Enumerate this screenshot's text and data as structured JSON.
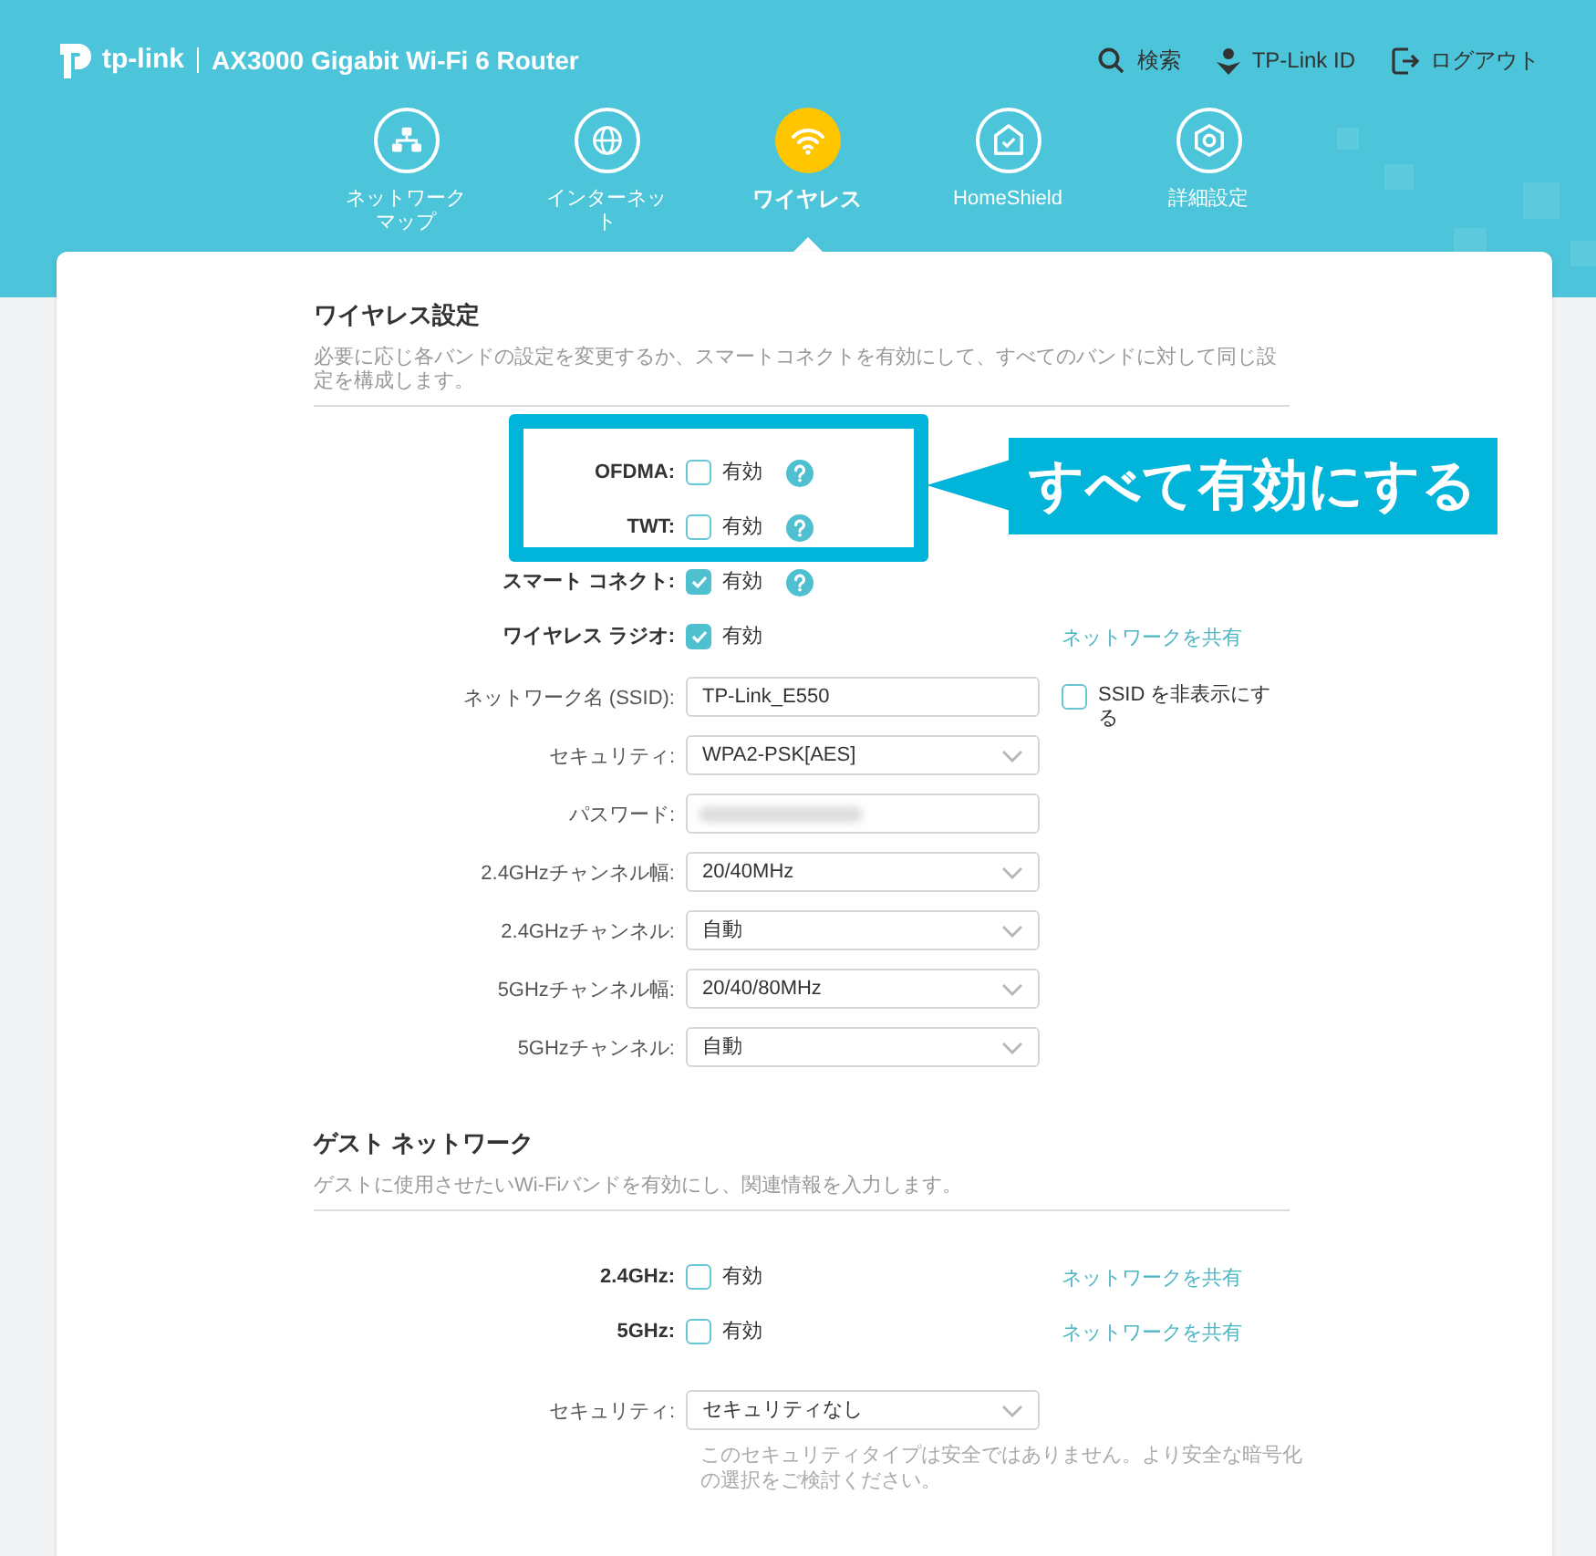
{
  "header": {
    "logo_text": "tp-link",
    "product": "AX3000 Gigabit Wi-Fi 6 Router",
    "actions": [
      {
        "kind": "search",
        "label": "検索"
      },
      {
        "kind": "id",
        "label": "TP-Link ID"
      },
      {
        "kind": "logout",
        "label": "ログアウト"
      }
    ]
  },
  "nav": [
    {
      "kind": "map",
      "label": "ネットワークマップ",
      "selected": false
    },
    {
      "kind": "globe",
      "label": "インターネット",
      "selected": false
    },
    {
      "kind": "wifi",
      "label": "ワイヤレス",
      "selected": true
    },
    {
      "kind": "shield",
      "label": "HomeShield",
      "selected": false
    },
    {
      "kind": "gear",
      "label": "詳細設定",
      "selected": false
    }
  ],
  "wireless": {
    "title": "ワイヤレス設定",
    "description": "必要に応じ各バンドの設定を変更するか、スマートコネクトを有効にして、すべてのバンドに対して同じ設定を構成します。",
    "rows": [
      {
        "kind": "checkbox",
        "label": "OFDMA:",
        "option": "有効",
        "checked": false,
        "help": true
      },
      {
        "kind": "checkbox",
        "label": "TWT:",
        "option": "有効",
        "checked": false,
        "help": true
      },
      {
        "kind": "checkbox",
        "label": "スマート コネクト:",
        "option": "有効",
        "checked": true,
        "help": true
      },
      {
        "kind": "checkbox",
        "label": "ワイヤレス ラジオ:",
        "option": "有効",
        "checked": true,
        "link": "ネットワークを共有"
      },
      {
        "kind": "text",
        "label": "ネットワーク名 (SSID):",
        "value": "TP-Link_E550",
        "extra": {
          "label": "SSID を非表示にする",
          "checked": false
        }
      },
      {
        "kind": "select",
        "label": "セキュリティ:",
        "value": "WPA2-PSK[AES]"
      },
      {
        "kind": "password",
        "label": "パスワード:"
      },
      {
        "kind": "select",
        "label": "2.4GHzチャンネル幅:",
        "value": "20/40MHz"
      },
      {
        "kind": "select",
        "label": "2.4GHzチャンネル:",
        "value": "自動"
      },
      {
        "kind": "select",
        "label": "5GHzチャンネル幅:",
        "value": "20/40/80MHz"
      },
      {
        "kind": "select",
        "label": "5GHzチャンネル:",
        "value": "自動"
      }
    ]
  },
  "guest": {
    "title": "ゲスト ネットワーク",
    "description": "ゲストに使用させたいWi-Fiバンドを有効にし、関連情報を入力します。",
    "rows": [
      {
        "kind": "checkbox",
        "label": "2.4GHz:",
        "option": "有効",
        "checked": false,
        "link": "ネットワークを共有"
      },
      {
        "kind": "checkbox",
        "label": "5GHz:",
        "option": "有効",
        "checked": false,
        "link": "ネットワークを共有"
      },
      {
        "kind": "select",
        "label": "セキュリティ:",
        "value": "セキュリティなし",
        "note": "このセキュリティタイプは安全ではありません。より安全な暗号化の選択をご検討ください。"
      }
    ]
  },
  "callout": {
    "text": "すべて有効にする"
  }
}
